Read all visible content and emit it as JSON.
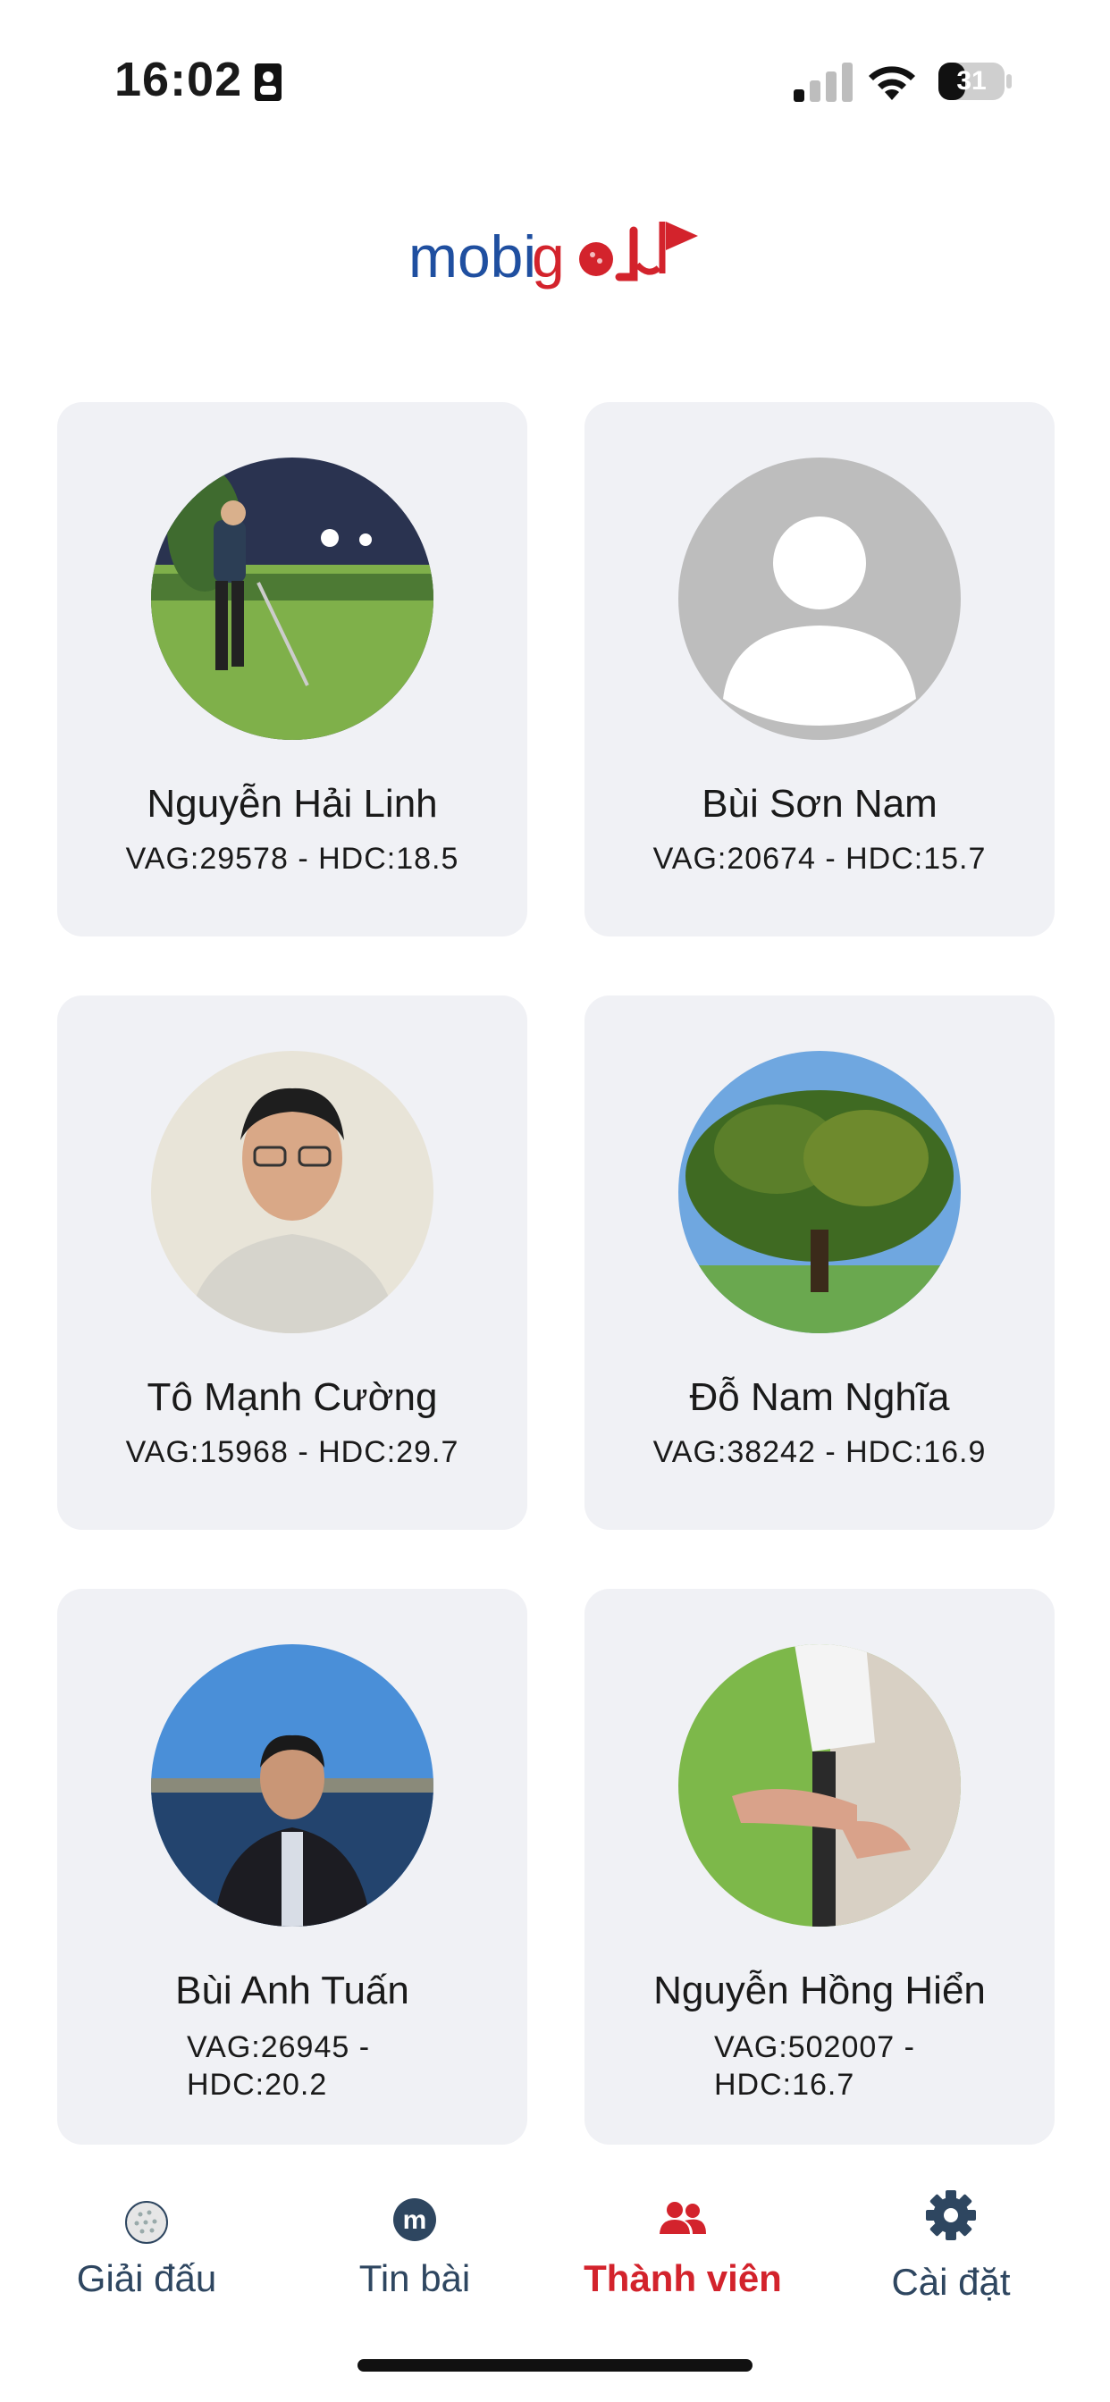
{
  "status_bar": {
    "time": "16:02",
    "battery_level": "31",
    "icons": [
      "id-badge-icon",
      "signal-icon",
      "wifi-icon",
      "battery-icon"
    ]
  },
  "header": {
    "logo_text_main": "mobigo",
    "brand_colors": {
      "blue": "#1f4fa0",
      "red": "#d3232c"
    }
  },
  "members": [
    {
      "name": "Nguyễn Hải Linh",
      "stats": "VAG:29578 - HDC:18.5",
      "avatar": "golfer-swing-photo"
    },
    {
      "name": "Bùi Sơn Nam",
      "stats": "VAG:20674 - HDC:15.7",
      "avatar": "default-user-placeholder"
    },
    {
      "name": "Tô Mạnh Cường",
      "stats": "VAG:15968 - HDC:29.7",
      "avatar": "man-portrait-photo"
    },
    {
      "name": "Đỗ Nam Nghĩa",
      "stats": "VAG:38242 - HDC:16.9",
      "avatar": "tree-photo"
    },
    {
      "name": "Bùi Anh Tuấn",
      "stats_line1": "VAG:26945 -",
      "stats_line2": "HDC:20.2",
      "avatar": "man-by-lake-photo"
    },
    {
      "name": "Nguyễn Hồng Hiển",
      "stats_line1": "VAG:502007 -",
      "stats_line2": "HDC:16.7",
      "avatar": "golf-grip-photo"
    }
  ],
  "nav": {
    "items": [
      {
        "label": "Giải đấu",
        "icon": "golf-ball-icon",
        "active": false
      },
      {
        "label": "Tin bài",
        "icon": "m-circle-icon",
        "active": false
      },
      {
        "label": "Thành viên",
        "icon": "users-icon",
        "active": true
      },
      {
        "label": "Cài đặt",
        "icon": "gear-icon",
        "active": false
      }
    ],
    "active_color": "#d3232c",
    "inactive_color": "#2e4660"
  }
}
